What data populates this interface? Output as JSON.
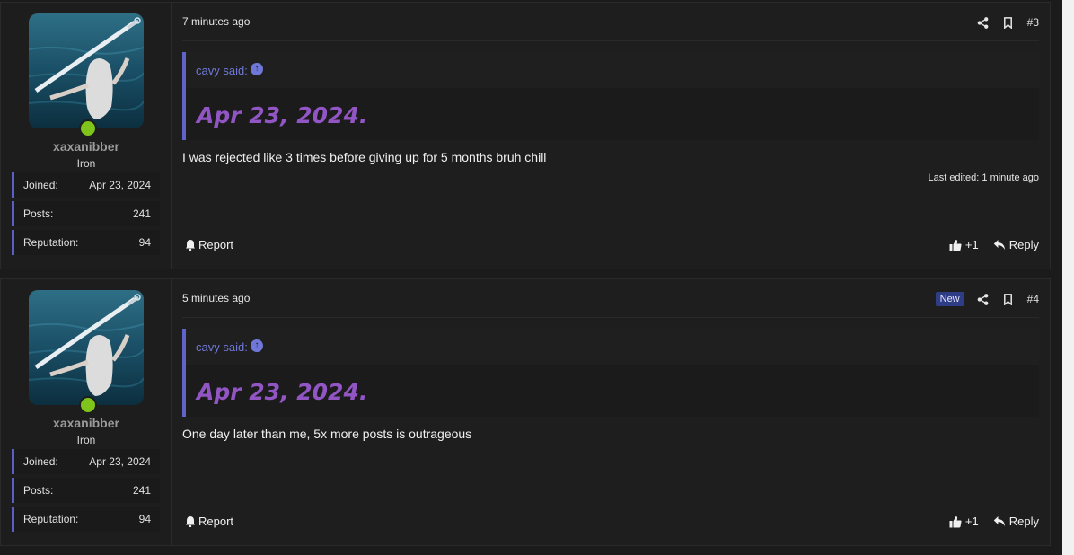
{
  "posts": [
    {
      "user": {
        "name": "xaxanibber",
        "rank": "Iron",
        "stats": [
          {
            "label": "Joined:",
            "value": "Apr 23, 2024"
          },
          {
            "label": "Posts:",
            "value": "241"
          },
          {
            "label": "Reputation:",
            "value": "94"
          }
        ]
      },
      "time": "7 minutes ago",
      "badge": "",
      "number": "#3",
      "quote": {
        "author": "cavy said:",
        "text": "Apr 23, 2024."
      },
      "body": "I was rejected like 3 times before giving up for 5 months bruh chill",
      "edited": "Last edited: 1 minute ago",
      "report_label": "Report",
      "like_count": "+1",
      "reply_label": "Reply"
    },
    {
      "user": {
        "name": "xaxanibber",
        "rank": "Iron",
        "stats": [
          {
            "label": "Joined:",
            "value": "Apr 23, 2024"
          },
          {
            "label": "Posts:",
            "value": "241"
          },
          {
            "label": "Reputation:",
            "value": "94"
          }
        ]
      },
      "time": "5 minutes ago",
      "badge": "New",
      "number": "#4",
      "quote": {
        "author": "cavy said:",
        "text": "Apr 23, 2024."
      },
      "body": "One day later than me, 5x more posts is outrageous",
      "edited": "",
      "report_label": "Report",
      "like_count": "+1",
      "reply_label": "Reply"
    }
  ],
  "colors": {
    "accent": "#5a5fc6",
    "quote_text": "#9256c4",
    "online": "#7fc41a",
    "badge_new": "#2f3c86"
  },
  "icons": {
    "share": "share-icon",
    "bookmark": "bookmark-icon",
    "report": "bell-icon",
    "like": "thumbs-up-icon",
    "reply": "reply-arrow-icon",
    "quote_jump": "arrow-up-circle-icon"
  }
}
